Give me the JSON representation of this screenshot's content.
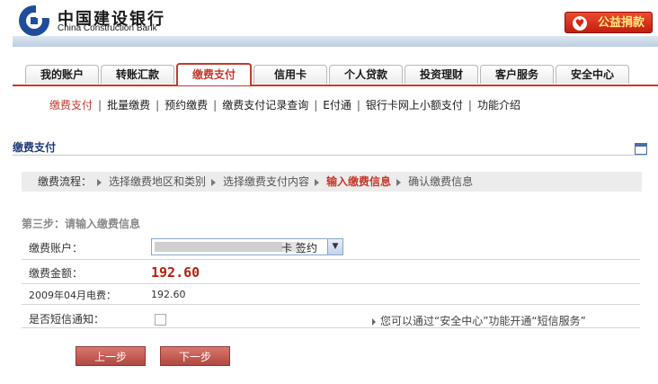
{
  "header": {
    "bank_name_cn": "中国建设银行",
    "bank_name_en": "China Construction Bank",
    "charity_button": "公益捐款",
    "charity_icon": "heart-icon"
  },
  "tabs": [
    {
      "label": "我的账户",
      "active": false
    },
    {
      "label": "转账汇款",
      "active": false
    },
    {
      "label": "缴费支付",
      "active": true
    },
    {
      "label": "信用卡",
      "active": false
    },
    {
      "label": "个人贷款",
      "active": false
    },
    {
      "label": "投资理财",
      "active": false
    },
    {
      "label": "客户服务",
      "active": false
    },
    {
      "label": "安全中心",
      "active": false
    }
  ],
  "subnav": [
    {
      "label": "缴费支付",
      "active": true
    },
    {
      "label": "批量缴费",
      "active": false
    },
    {
      "label": "预约缴费",
      "active": false
    },
    {
      "label": "缴费支付记录查询",
      "active": false
    },
    {
      "label": "E付通",
      "active": false
    },
    {
      "label": "银行卡网上小额支付",
      "active": false
    },
    {
      "label": "功能介绍",
      "active": false
    }
  ],
  "section_title": "缴费支付",
  "flow": {
    "label": "缴费流程：",
    "steps": [
      {
        "label": "选择缴费地区和类别",
        "current": false
      },
      {
        "label": "选择缴费支付内容",
        "current": false
      },
      {
        "label": "输入缴费信息",
        "current": true
      },
      {
        "label": "确认缴费信息",
        "current": false
      }
    ]
  },
  "step_heading": "第三步：请输入缴费信息",
  "form": {
    "account_label": "缴费账户：",
    "account_value": "卡 签约",
    "amount_label": "缴费金额：",
    "amount_value": "192.60",
    "bill_label": "2009年04月电费：",
    "bill_value": "192.60",
    "sms_label": "是否短信通知：",
    "sms_checked": false,
    "sms_hint": "您可以通过“安全中心”功能开通“短信服务”"
  },
  "buttons": {
    "prev": "上一步",
    "next": "下一步"
  },
  "colors": {
    "accent_red": "#c43a2c",
    "amount_red": "#b8200c",
    "title_blue": "#1e3a78"
  }
}
